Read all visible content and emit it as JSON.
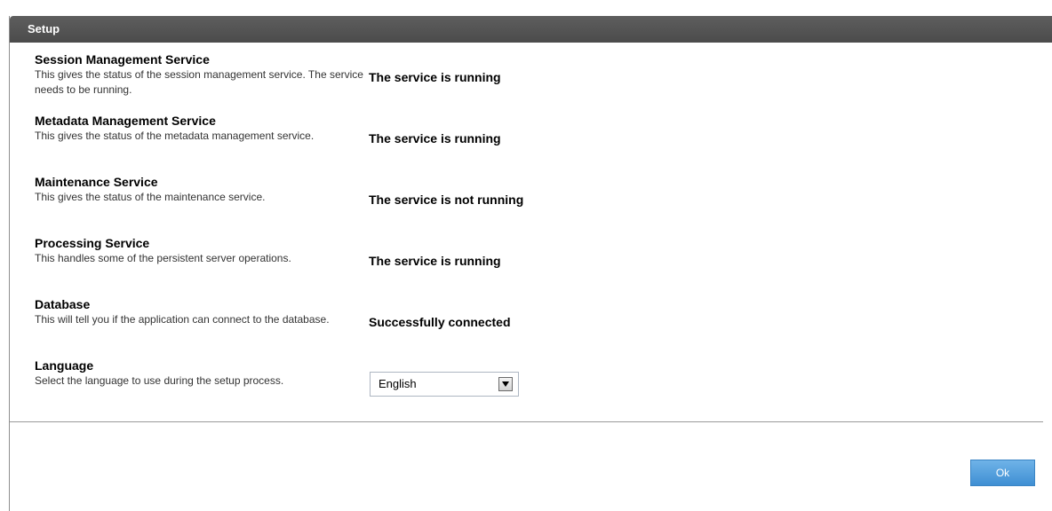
{
  "header": {
    "title": "Setup"
  },
  "services": [
    {
      "title": "Session Management Service",
      "description": "This gives the status of the session management service. The service needs to be running.",
      "status": "The service is running"
    },
    {
      "title": "Metadata Management Service",
      "description": "This gives the status of the metadata management service.",
      "status": "The service is running"
    },
    {
      "title": "Maintenance Service",
      "description": "This gives the status of the maintenance service.",
      "status": "The service is not running"
    },
    {
      "title": "Processing Service",
      "description": "This handles some of the persistent server operations.",
      "status": "The service is running"
    },
    {
      "title": "Database",
      "description": "This will tell you if the application can connect to the database.",
      "status": "Successfully connected"
    }
  ],
  "language": {
    "title": "Language",
    "description": "Select the language to use during the setup process.",
    "selected": "English"
  },
  "footer": {
    "ok_label": "Ok"
  }
}
